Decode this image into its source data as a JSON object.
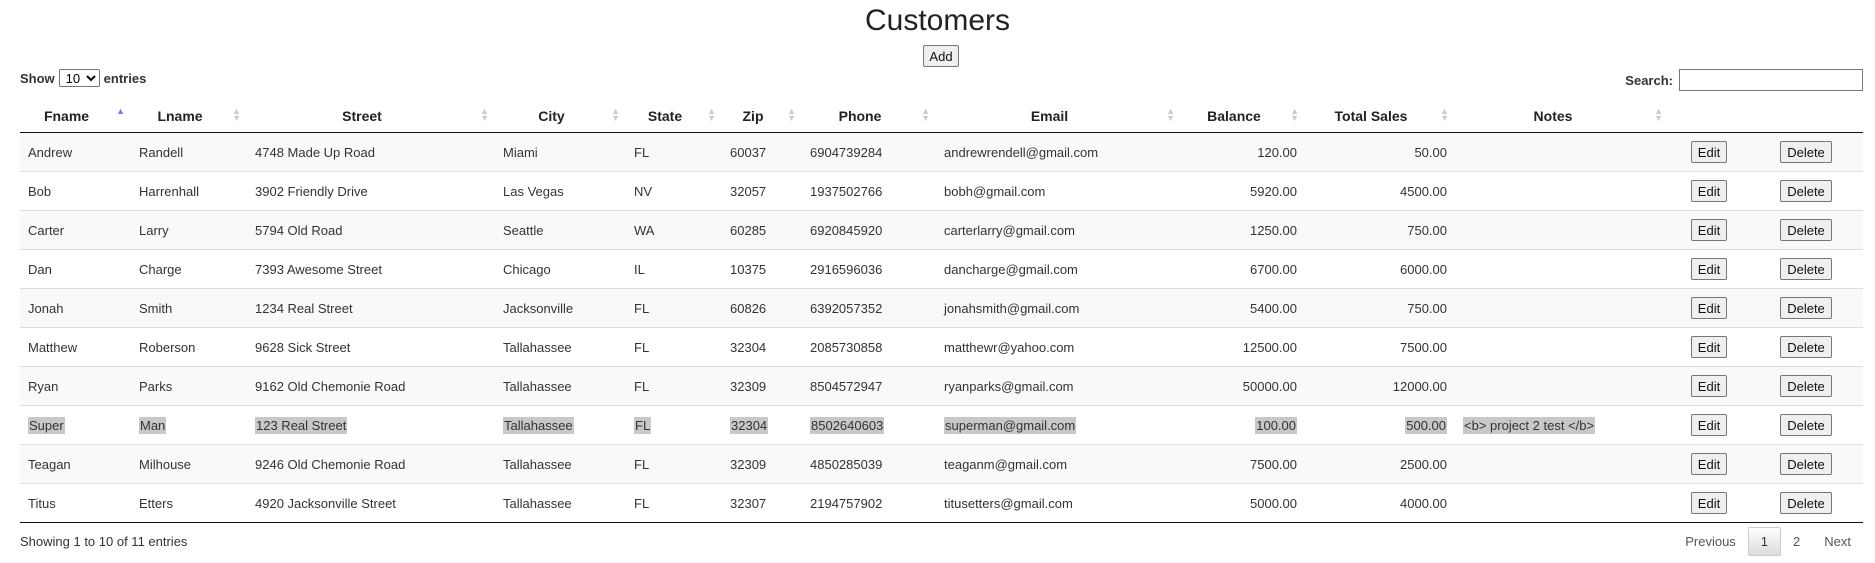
{
  "page": {
    "title": "Customers",
    "add_label": "Add"
  },
  "length": {
    "prefix": "Show",
    "selected": "10",
    "suffix": "entries"
  },
  "search": {
    "label": "Search:",
    "value": ""
  },
  "columns": [
    "Fname",
    "Lname",
    "Street",
    "City",
    "State",
    "Zip",
    "Phone",
    "Email",
    "Balance",
    "Total Sales",
    "Notes"
  ],
  "sorted_column": "Fname",
  "row_buttons": {
    "edit": "Edit",
    "delete": "Delete"
  },
  "rows": [
    {
      "fname": "Andrew",
      "lname": "Randell",
      "street": "4748 Made Up Road",
      "city": "Miami",
      "state": "FL",
      "zip": "60037",
      "phone": "6904739284",
      "email": "andrewrendell@gmail.com",
      "balance": "120.00",
      "total_sales": "50.00",
      "notes": "",
      "selected": false
    },
    {
      "fname": "Bob",
      "lname": "Harrenhall",
      "street": "3902 Friendly Drive",
      "city": "Las Vegas",
      "state": "NV",
      "zip": "32057",
      "phone": "1937502766",
      "email": "bobh@gmail.com",
      "balance": "5920.00",
      "total_sales": "4500.00",
      "notes": "",
      "selected": false
    },
    {
      "fname": "Carter",
      "lname": "Larry",
      "street": "5794 Old Road",
      "city": "Seattle",
      "state": "WA",
      "zip": "60285",
      "phone": "6920845920",
      "email": "carterlarry@gmail.com",
      "balance": "1250.00",
      "total_sales": "750.00",
      "notes": "",
      "selected": false
    },
    {
      "fname": "Dan",
      "lname": "Charge",
      "street": "7393 Awesome Street",
      "city": "Chicago",
      "state": "IL",
      "zip": "10375",
      "phone": "2916596036",
      "email": "dancharge@gmail.com",
      "balance": "6700.00",
      "total_sales": "6000.00",
      "notes": "",
      "selected": false
    },
    {
      "fname": "Jonah",
      "lname": "Smith",
      "street": "1234 Real Street",
      "city": "Jacksonville",
      "state": "FL",
      "zip": "60826",
      "phone": "6392057352",
      "email": "jonahsmith@gmail.com",
      "balance": "5400.00",
      "total_sales": "750.00",
      "notes": "",
      "selected": false
    },
    {
      "fname": "Matthew",
      "lname": "Roberson",
      "street": "9628 Sick Street",
      "city": "Tallahassee",
      "state": "FL",
      "zip": "32304",
      "phone": "2085730858",
      "email": "matthewr@yahoo.com",
      "balance": "12500.00",
      "total_sales": "7500.00",
      "notes": "",
      "selected": false
    },
    {
      "fname": "Ryan",
      "lname": "Parks",
      "street": "9162 Old Chemonie Road",
      "city": "Tallahassee",
      "state": "FL",
      "zip": "32309",
      "phone": "8504572947",
      "email": "ryanparks@gmail.com",
      "balance": "50000.00",
      "total_sales": "12000.00",
      "notes": "",
      "selected": false
    },
    {
      "fname": "Super",
      "lname": "Man",
      "street": "123 Real Street",
      "city": "Tallahassee",
      "state": "FL",
      "zip": "32304",
      "phone": "8502640603",
      "email": "superman@gmail.com",
      "balance": "100.00",
      "total_sales": "500.00",
      "notes": "<b> project 2 test </b>",
      "selected": true
    },
    {
      "fname": "Teagan",
      "lname": "Milhouse",
      "street": "9246 Old Chemonie Road",
      "city": "Tallahassee",
      "state": "FL",
      "zip": "32309",
      "phone": "4850285039",
      "email": "teaganm@gmail.com",
      "balance": "7500.00",
      "total_sales": "2500.00",
      "notes": "",
      "selected": false
    },
    {
      "fname": "Titus",
      "lname": "Etters",
      "street": "4920 Jacksonville Street",
      "city": "Tallahassee",
      "state": "FL",
      "zip": "32307",
      "phone": "2194757902",
      "email": "titusetters@gmail.com",
      "balance": "5000.00",
      "total_sales": "4000.00",
      "notes": "",
      "selected": false
    }
  ],
  "info": "Showing 1 to 10 of 11 entries",
  "pagination": {
    "previous": "Previous",
    "pages": [
      "1",
      "2"
    ],
    "current": "1",
    "next": "Next"
  },
  "colors": {
    "sort_active": "#7a7ae6",
    "selection": "#c8c8c8"
  }
}
